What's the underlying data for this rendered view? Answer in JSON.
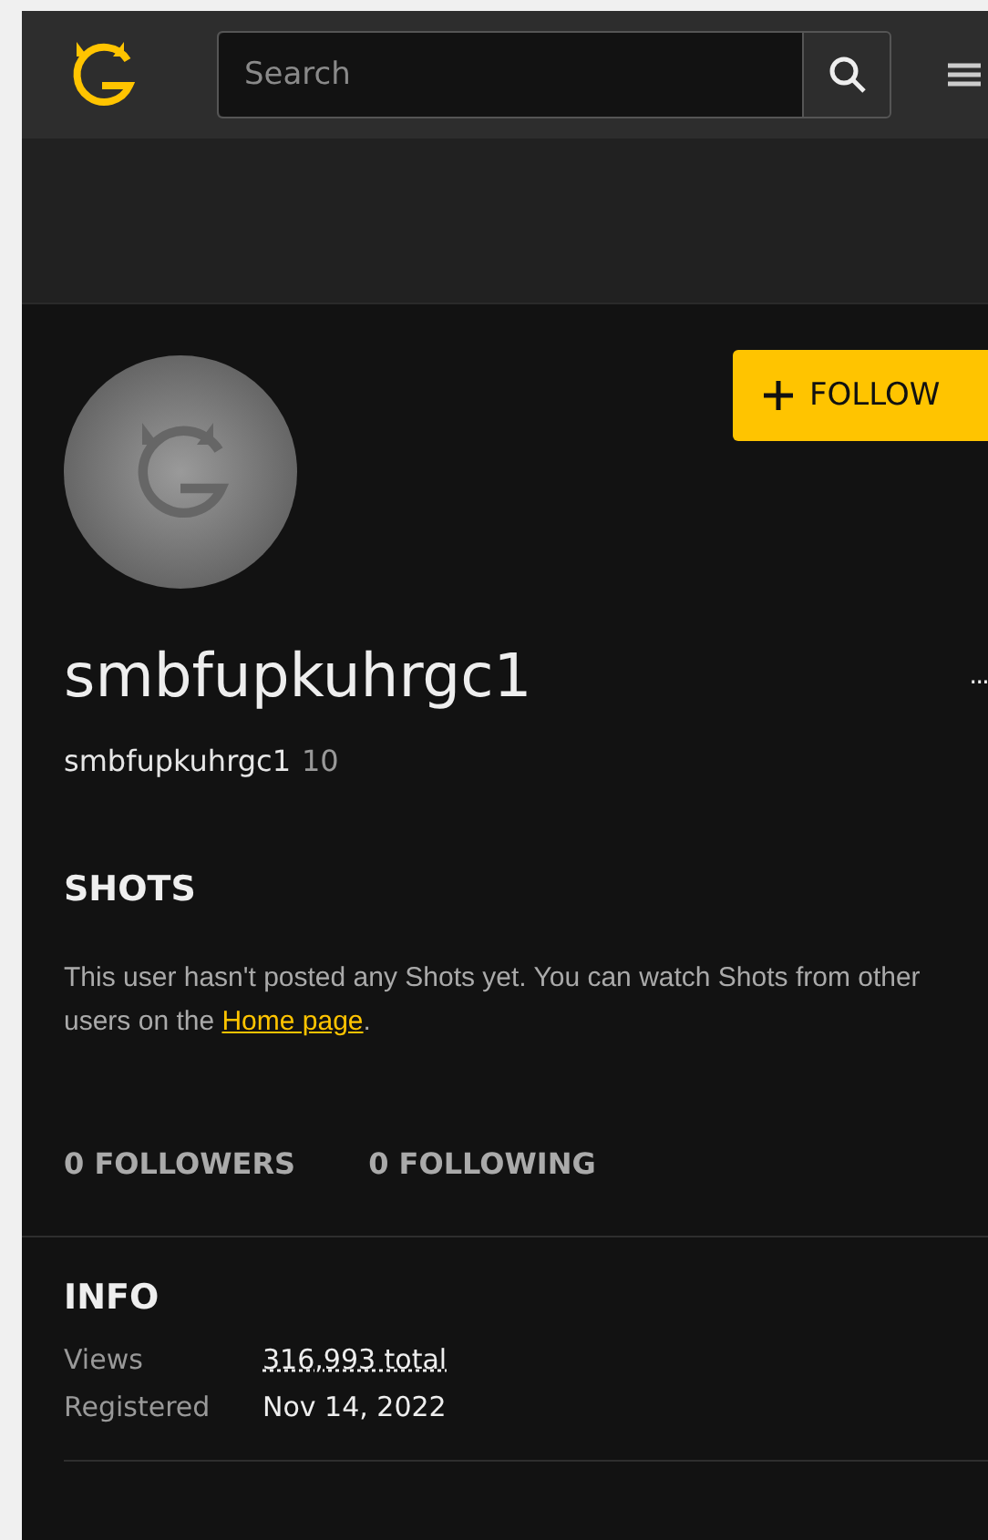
{
  "header": {
    "search": {
      "placeholder": "Search"
    }
  },
  "profile": {
    "follow_button": {
      "label": "FOLLOW"
    },
    "display_name": "smbfupkuhrgc1",
    "more_button": {
      "label": "..."
    },
    "username": "smbfupkuhrgc1",
    "level": "10"
  },
  "shots": {
    "title": "SHOTS",
    "message": "This user hasn't posted any Shots yet. You can watch Shots from other users on the ",
    "link": "Home page",
    "message_end": "."
  },
  "stats": [
    {
      "label": "0 FOLLOWERS"
    },
    {
      "label": "0 FOLLOWING"
    }
  ],
  "info": {
    "title": "INFO",
    "rows": [
      {
        "label": "Views",
        "value": "316,993 total",
        "kind": "dotted"
      },
      {
        "label": "Registered",
        "value": "Nov 14, 2022",
        "kind": "plain"
      }
    ]
  }
}
